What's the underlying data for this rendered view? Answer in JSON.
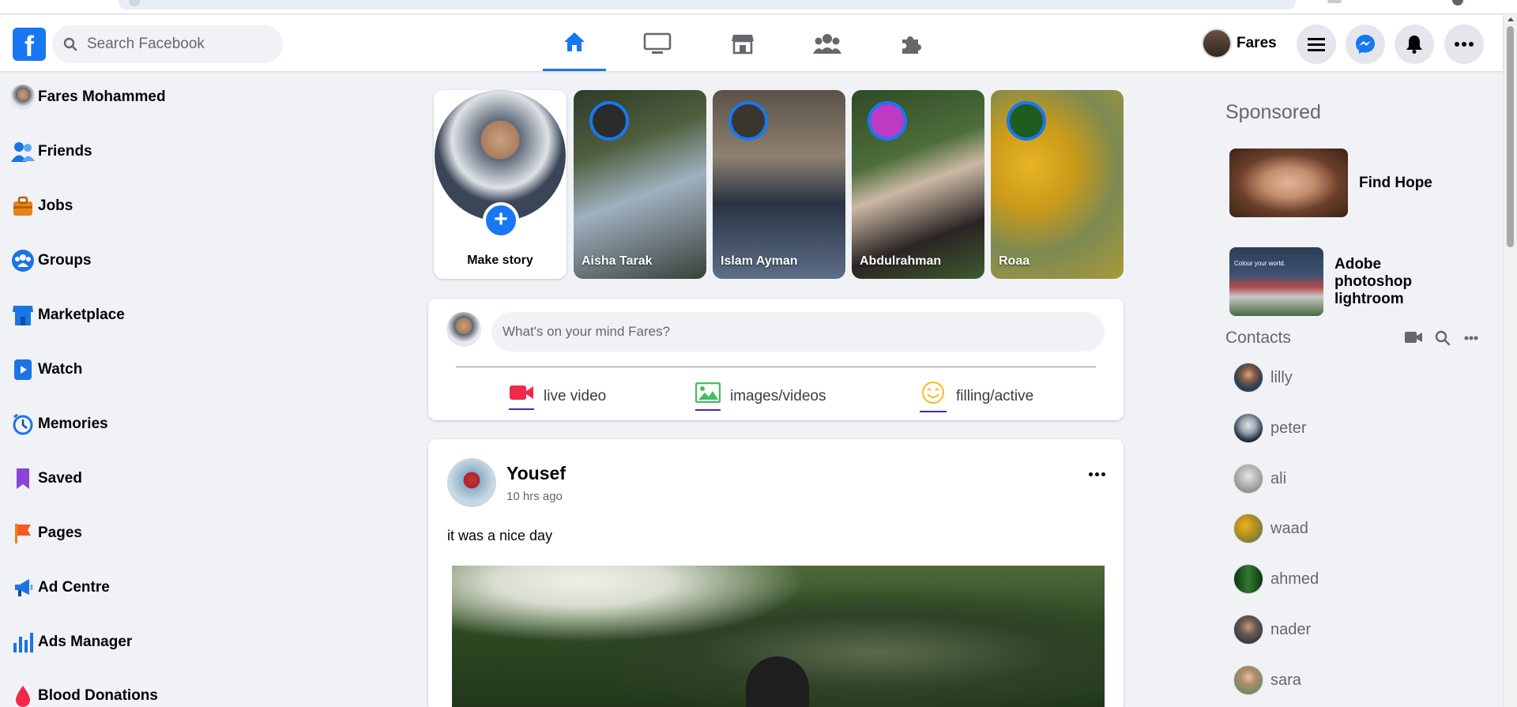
{
  "colors": {
    "brand": "#1877f2",
    "background": "#f0f2f5"
  },
  "header": {
    "logo": "f",
    "search_placeholder": "Search Facebook",
    "nav": [
      {
        "name": "home-icon",
        "active": true
      },
      {
        "name": "watch-icon",
        "active": false
      },
      {
        "name": "marketplace-icon",
        "active": false
      },
      {
        "name": "groups-icon",
        "active": false
      },
      {
        "name": "gaming-icon",
        "active": false
      }
    ],
    "profile_name": "Fares",
    "buttons": [
      "menu-icon",
      "messenger-icon",
      "bell-icon",
      "more-icon"
    ]
  },
  "sidebar": {
    "profile_name": "Fares Mohammed",
    "items": [
      {
        "label": "Friends",
        "icon": "friends-icon"
      },
      {
        "label": "Jobs",
        "icon": "jobs-icon"
      },
      {
        "label": "Groups",
        "icon": "groups-icon"
      },
      {
        "label": "Marketplace",
        "icon": "marketplace-icon"
      },
      {
        "label": "Watch",
        "icon": "watch-icon"
      },
      {
        "label": "Memories",
        "icon": "memories-icon"
      },
      {
        "label": "Saved",
        "icon": "saved-icon"
      },
      {
        "label": "Pages",
        "icon": "pages-icon"
      },
      {
        "label": "Ad Centre",
        "icon": "megaphone-icon"
      },
      {
        "label": "Ads Manager",
        "icon": "bar-chart-icon"
      },
      {
        "label": "Blood Donations",
        "icon": "blood-drop-icon"
      }
    ]
  },
  "stories": {
    "make_story_label": "Make story",
    "items": [
      {
        "name": "Aisha Tarak"
      },
      {
        "name": "Islam Ayman"
      },
      {
        "name": "Abdulrahman"
      },
      {
        "name": "Roaa"
      }
    ]
  },
  "composer": {
    "placeholder": "What's on your mind Fares?",
    "actions": [
      {
        "label": "live video",
        "icon": "video-camera-icon"
      },
      {
        "label": "images/videos",
        "icon": "image-icon"
      },
      {
        "label": "filling/active",
        "icon": "smile-icon"
      }
    ]
  },
  "post": {
    "author": "Yousef",
    "time": "10 hrs ago",
    "text": "it was a nice day"
  },
  "sponsored": {
    "title": "Sponsored",
    "ads": [
      {
        "title": "Find Hope"
      },
      {
        "title": "Adobe photoshop lightroom",
        "image_caption": "Colour your world."
      }
    ]
  },
  "contacts": {
    "title": "Contacts",
    "items": [
      "lilly",
      "peter",
      "ali",
      "waad",
      "ahmed",
      "nader",
      "sara"
    ]
  }
}
